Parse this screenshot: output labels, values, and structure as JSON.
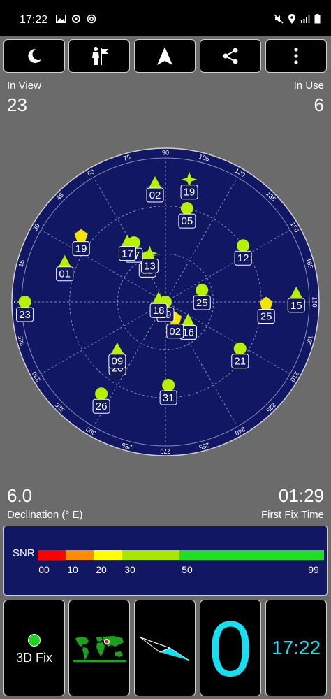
{
  "status_bar": {
    "time": "17:22",
    "icons": [
      "image-icon",
      "sync-icon",
      "at-icon",
      "mute-icon",
      "location-icon",
      "signal-icon",
      "battery-icon"
    ]
  },
  "toolbar": {
    "buttons": [
      "night-mode-icon",
      "guide-icon",
      "navigation-arrow-icon",
      "share-icon",
      "overflow-menu-icon"
    ]
  },
  "counts": {
    "in_view_label": "In View",
    "in_view_value": "23",
    "in_use_label": "In Use",
    "in_use_value": "6"
  },
  "sky_plot": {
    "azimuth_labels": [
      "0",
      "15",
      "30",
      "45",
      "60",
      "75",
      "90",
      "105",
      "120",
      "135",
      "150",
      "165",
      "180",
      "195",
      "210",
      "225",
      "240",
      "255",
      "270",
      "285",
      "300",
      "315",
      "330",
      "345"
    ],
    "satellites": [
      {
        "id": "21",
        "shape": "circle",
        "az": 212,
        "el": 35,
        "used": false
      },
      {
        "id": "31",
        "shape": "circle",
        "az": 268,
        "el": 38,
        "used": false
      },
      {
        "id": "26",
        "shape": "circle",
        "az": 305,
        "el": 20,
        "used": false
      },
      {
        "id": "20",
        "shape": "pentagon",
        "az": 312,
        "el": 45,
        "used": true
      },
      {
        "id": "09",
        "shape": "triangle",
        "az": 316,
        "el": 48,
        "used": false
      },
      {
        "id": "16",
        "shape": "triangle",
        "az": 218,
        "el": 72,
        "used": false
      },
      {
        "id": "02",
        "shape": "pentagon",
        "az": 240,
        "el": 78,
        "used": true
      },
      {
        "id": "15",
        "shape": "triangle",
        "az": 176,
        "el": 8,
        "used": false
      },
      {
        "id": "25",
        "shape": "pentagon",
        "az": 181,
        "el": 27,
        "used": true
      },
      {
        "id": "29",
        "shape": "circle",
        "az": 0,
        "el": 90,
        "used": false
      },
      {
        "id": "18",
        "shape": "triangle",
        "az": 30,
        "el": 85,
        "used": false
      },
      {
        "id": "25",
        "shape": "circle",
        "az": 162,
        "el": 66,
        "used": false
      },
      {
        "id": "23",
        "shape": "circle",
        "az": 0,
        "el": 2,
        "used": false
      },
      {
        "id": "12",
        "shape": "circle",
        "az": 144,
        "el": 30,
        "used": false
      },
      {
        "id": "01",
        "shape": "triangle",
        "az": 22,
        "el": 22,
        "used": false
      },
      {
        "id": "11",
        "shape": "circle",
        "az": 68,
        "el": 60,
        "used": false
      },
      {
        "id": "13",
        "shape": "star",
        "az": 72,
        "el": 58,
        "used": false
      },
      {
        "id": "07",
        "shape": "circle",
        "az": 62,
        "el": 48,
        "used": false
      },
      {
        "id": "17",
        "shape": "triangle",
        "az": 58,
        "el": 45,
        "used": false
      },
      {
        "id": "19",
        "shape": "pentagon",
        "az": 38,
        "el": 23,
        "used": true
      },
      {
        "id": "05",
        "shape": "circle",
        "az": 103,
        "el": 30,
        "used": false
      },
      {
        "id": "19",
        "shape": "star",
        "az": 101,
        "el": 12,
        "used": false
      },
      {
        "id": "02",
        "shape": "triangle",
        "az": 85,
        "el": 15,
        "used": false
      }
    ]
  },
  "readouts": {
    "declination_value": "6.0",
    "declination_label": "Declination (° E)",
    "first_fix_value": "01:29",
    "first_fix_label": "First Fix Time"
  },
  "snr": {
    "label": "SNR",
    "ticks": [
      "00",
      "10",
      "20",
      "30",
      "50",
      "99"
    ],
    "colors": [
      "#ff0000",
      "#ff8c00",
      "#ffff00",
      "#a8e600",
      "#22dd22"
    ]
  },
  "bottom_tiles": {
    "fix_label": "3D Fix",
    "fix_color": "#22d321",
    "map_icon": "world-map-icon",
    "compass_icon": "compass-needle-icon",
    "big_value": "0",
    "clock": "17:22"
  }
}
